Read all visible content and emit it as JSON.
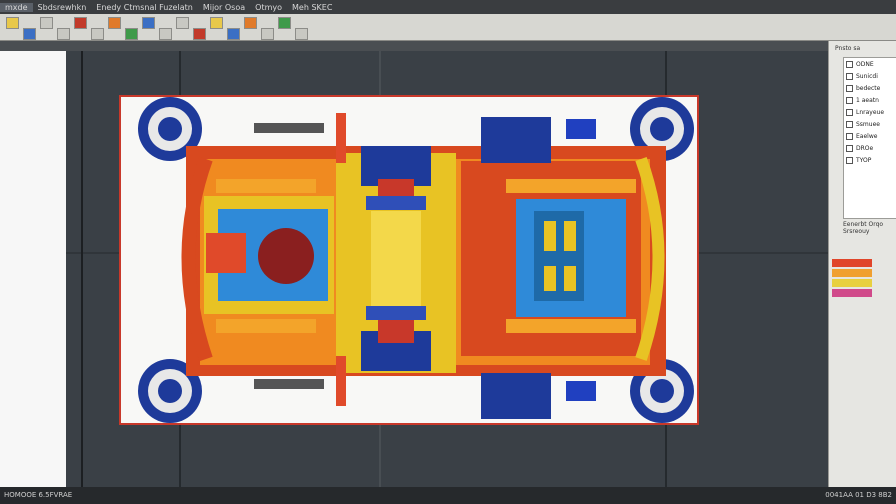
{
  "titlebar": {
    "items": [
      "mxde",
      "Sbdsrewhkn",
      "Enedy Ctmsnal Fuzelatn",
      "Mijor Osoa",
      "Otmyo",
      "Meh SKEC"
    ]
  },
  "toolbar": {
    "buttons": [
      {
        "icon": "folder-icon",
        "color": "yellow"
      },
      {
        "icon": "save-icon",
        "color": "blue"
      },
      {
        "icon": "undo-icon",
        "color": "grey"
      },
      {
        "icon": "redo-icon",
        "color": "grey"
      },
      {
        "icon": "cut-icon",
        "color": "red"
      },
      {
        "icon": "copy-icon",
        "color": "grey"
      },
      {
        "icon": "paste-icon",
        "color": "orange"
      },
      {
        "icon": "zoom-icon",
        "color": "green"
      },
      {
        "icon": "rotate-icon",
        "color": "blue"
      },
      {
        "icon": "pan-icon",
        "color": "grey"
      },
      {
        "icon": "select-icon",
        "color": "grey"
      },
      {
        "icon": "measure-icon",
        "color": "red"
      },
      {
        "icon": "section-icon",
        "color": "yellow"
      },
      {
        "icon": "mesh-icon",
        "color": "blue"
      },
      {
        "icon": "render-icon",
        "color": "orange"
      },
      {
        "icon": "grid-icon",
        "color": "grey"
      },
      {
        "icon": "layers-icon",
        "color": "green"
      },
      {
        "icon": "settings-icon",
        "color": "grey"
      }
    ]
  },
  "panel": {
    "title": "Pnsto sa",
    "rows": [
      "ODNE",
      "Sunicdi",
      "bedecte",
      "1 aeatn",
      "Lnrayeue",
      "Ssmuee",
      "Eaelwe",
      "DROe",
      "TYOP"
    ],
    "props": [
      "Eenerbt Orqo",
      "Srsreouy"
    ]
  },
  "legend": {
    "colors": [
      "#e0452a",
      "#f0a030",
      "#e8d040",
      "#d04a8a"
    ],
    "labels": [
      "",
      "",
      "",
      ""
    ]
  },
  "status": {
    "left": "HOMOOE 6.5FVRAE",
    "right": "0041AA 01 D3 8B2"
  }
}
